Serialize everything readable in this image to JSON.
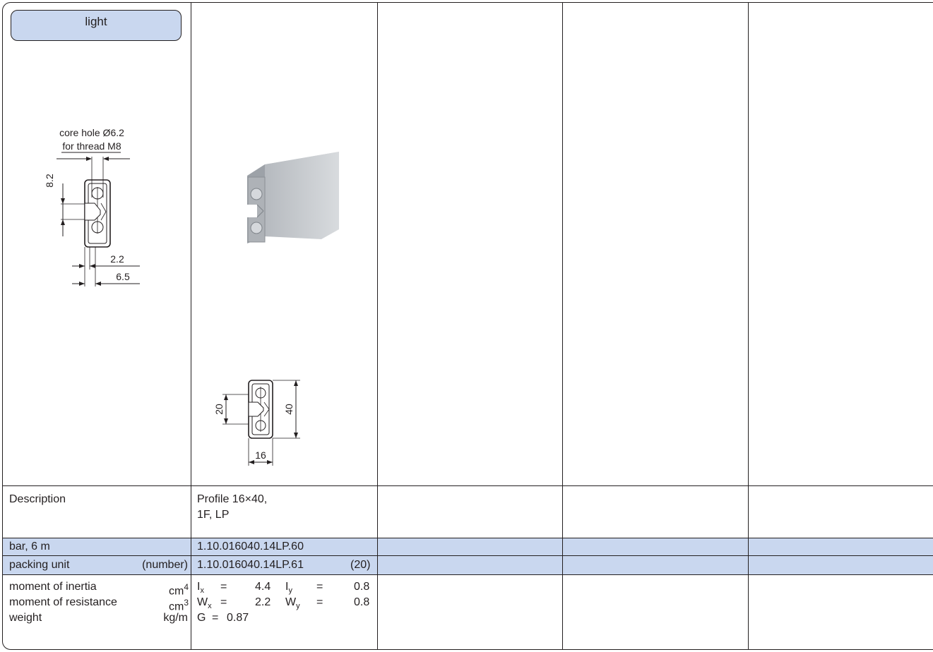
{
  "header": {
    "category_label": "light"
  },
  "drawing_left": {
    "core_hole_label": "core hole Ø6.2",
    "thread_label": "for thread M8",
    "dim_height": "8.2",
    "dim_small": "2.2",
    "dim_width": "6.5"
  },
  "drawing_bottom": {
    "dim_20": "20",
    "dim_40": "40",
    "dim_16": "16"
  },
  "table": {
    "description_label": "Description",
    "description_value_line1": "Profile 16×40,",
    "description_value_line2": "1F, LP",
    "bar_label": "bar, 6 m",
    "bar_value": "1.10.016040.14LP.60",
    "packing_label": "packing unit",
    "packing_unit": "(number)",
    "packing_value": "1.10.016040.14LP.61",
    "packing_count": "(20)",
    "inertia_label": "moment of inertia",
    "inertia_unit": "cm",
    "inertia_exp": "4",
    "resistance_label": "moment of resistance",
    "resistance_unit": "cm",
    "resistance_exp": "3",
    "weight_label": "weight",
    "weight_unit": "kg/m",
    "ix_sym": "I",
    "ix_sub": "x",
    "ix_val": "4.4",
    "iy_sym": "I",
    "iy_sub": "y",
    "iy_val": "0.8",
    "wx_sym": "W",
    "wx_sub": "x",
    "wx_val": "2.2",
    "wy_sym": "W",
    "wy_sub": "y",
    "wy_val": "0.8",
    "g_sym": "G",
    "g_val": "0.87",
    "eq": "="
  },
  "colors": {
    "band": "#c9d7ef",
    "line": "#231f20"
  }
}
